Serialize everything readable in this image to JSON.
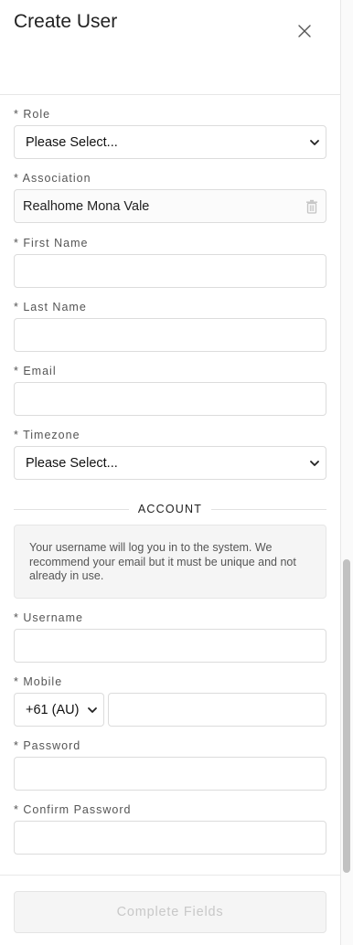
{
  "header": {
    "title": "Create User",
    "close_icon": "close-icon"
  },
  "form": {
    "role": {
      "label": "* Role",
      "value": "Please Select..."
    },
    "association": {
      "label": "* Association",
      "value": "Realhome Mona Vale",
      "action_icon": "trash-icon"
    },
    "first_name": {
      "label": "* First Name",
      "value": ""
    },
    "last_name": {
      "label": "* Last Name",
      "value": ""
    },
    "email": {
      "label": "* Email",
      "value": ""
    },
    "timezone": {
      "label": "* Timezone",
      "value": "Please Select..."
    },
    "account_section": {
      "title": "ACCOUNT",
      "info": "Your username will log you in to the system. We recommend your email but it must be unique and not already in use."
    },
    "username": {
      "label": "* Username",
      "value": ""
    },
    "mobile": {
      "label": "* Mobile",
      "country_code": "+61 (AU)",
      "value": ""
    },
    "password": {
      "label": "* Password",
      "value": ""
    },
    "confirm_password": {
      "label": "* Confirm Password",
      "value": ""
    }
  },
  "footer": {
    "submit_label": "Complete Fields"
  },
  "colors": {
    "border": "#dcdcdc",
    "disabled_text": "#c8c8c8",
    "info_bg": "#f5f5f5"
  }
}
